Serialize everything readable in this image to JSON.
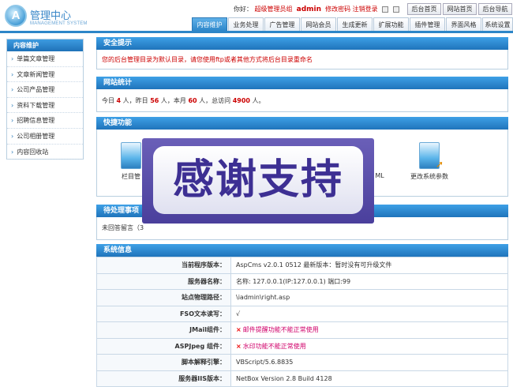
{
  "brand": {
    "cn": "管理中心",
    "en": "MANAGEMENT SYSTEM",
    "logo_letter": "A"
  },
  "userline": {
    "greeting": "你好：",
    "role": "超级管理员组",
    "username": "admin",
    "change_pwd": "修改密码",
    "logout": "注销登录"
  },
  "top_buttons": [
    "后台首页",
    "网站首页",
    "后台导航"
  ],
  "nav_tabs": [
    "内容维护",
    "业务处理",
    "广告管理",
    "网站会员",
    "生成更新",
    "扩展功能",
    "插件管理",
    "界面风格",
    "系统设置"
  ],
  "sidebar": {
    "title": "内容维护",
    "items": [
      "单篇文章管理",
      "文章新闻管理",
      "公司产品管理",
      "资料下载管理",
      "招聘信息管理",
      "公司相册管理",
      "内容回收站"
    ]
  },
  "security": {
    "title": "安全提示",
    "text": "您的后台管理目录为默认目录，请您使用ftp或者其他方式将后台目录重命名"
  },
  "stats": {
    "title": "网站统计",
    "today_label": "今日",
    "today": "4",
    "yesterday_label": "，昨日",
    "yesterday": "56",
    "month_label": "，本月",
    "month": "60",
    "total_label": "，总访问",
    "total": "4900",
    "unit": "人",
    "end": "。"
  },
  "quick": {
    "title": "快捷功能",
    "items": [
      "栏目管",
      "ML",
      "更改系统参数"
    ]
  },
  "pending": {
    "title": "待处理事项",
    "text": "未回答留言（3"
  },
  "sysinfo": {
    "title": "系统信息",
    "rows": [
      {
        "k": "当前程序版本：",
        "v": "AspCms v2.0.1 0512 最新版本：暂时没有可升级文件",
        "err": false
      },
      {
        "k": "服务器名称：",
        "v": "名称: 127.0.0.1(IP:127.0.0.1) 端口:99",
        "err": false
      },
      {
        "k": "站点物理路径：",
        "v": "\\iadmin\\right.asp",
        "err": false
      },
      {
        "k": "FSO文本读写：",
        "v": "√",
        "err": false
      },
      {
        "k": "JMail组件：",
        "v": "邮件提醒功能不能正常使用",
        "err": true
      },
      {
        "k": "ASPJpeg 组件：",
        "v": "水印功能不能正常使用",
        "err": true
      },
      {
        "k": "脚本解释引擎：",
        "v": "VBScript/5.6.8835",
        "err": false
      },
      {
        "k": "服务器IIS版本：",
        "v": "NetBox Version 2.8 Build 4128",
        "err": false
      }
    ],
    "err_mark": "×"
  },
  "overlay": {
    "text": "感谢支持"
  },
  "colors": {
    "accent": "#2d86c8",
    "alert": "#cc0000"
  }
}
